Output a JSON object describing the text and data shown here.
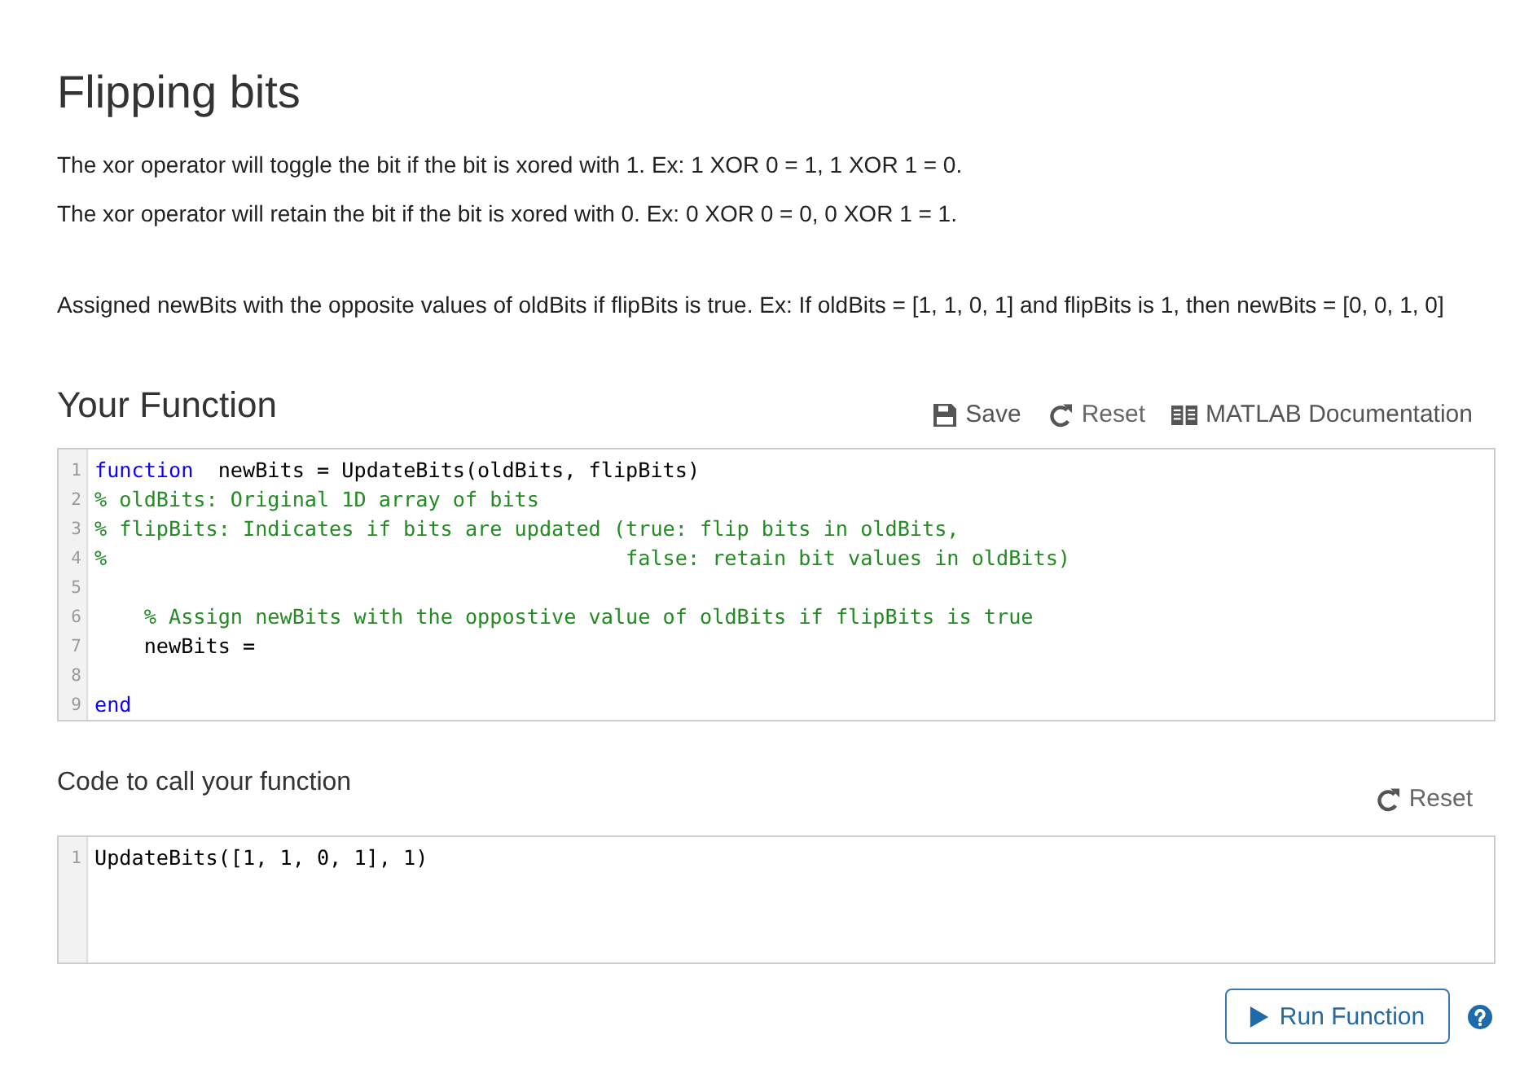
{
  "title": "Flipping bits",
  "notes": [
    "The xor operator will toggle the bit if the bit is xored with 1. Ex: 1 XOR 0 = 1, 1 XOR 1 = 0.",
    "The xor operator will retain the bit if the bit is xored with 0. Ex: 0 XOR 0 = 0, 0 XOR 1 = 1."
  ],
  "task": "Assigned newBits with the opposite values of oldBits if flipBits is true. Ex: If oldBits = [1, 1, 0, 1] and flipBits is 1, then newBits = [0, 0, 1, 0]",
  "function_editor": {
    "heading": "Your Function",
    "toolbar": [
      {
        "kind": "save",
        "label": "Save"
      },
      {
        "kind": "reset",
        "label": "Reset"
      },
      {
        "kind": "docs",
        "label": "MATLAB Documentation"
      }
    ],
    "lines": [
      {
        "number": "1",
        "tokens": [
          {
            "kind": "keyword",
            "text": "function"
          },
          {
            "kind": "plain",
            "text": "  newBits = UpdateBits(oldBits, flipBits)"
          }
        ]
      },
      {
        "number": "2",
        "tokens": [
          {
            "kind": "comment",
            "text": "% oldBits: Original 1D array of bits"
          }
        ]
      },
      {
        "number": "3",
        "tokens": [
          {
            "kind": "comment",
            "text": "% flipBits: Indicates if bits are updated (true: flip bits in oldBits,"
          }
        ]
      },
      {
        "number": "4",
        "tokens": [
          {
            "kind": "comment",
            "text": "%                                          false: retain bit values in oldBits)"
          }
        ]
      },
      {
        "number": "5"
      },
      {
        "number": "6",
        "tokens": [
          {
            "kind": "comment",
            "text": "    % Assign newBits with the oppostive value of oldBits if flipBits is true"
          }
        ]
      },
      {
        "number": "7",
        "tokens": [
          {
            "kind": "plain",
            "text": "    newBits ="
          }
        ]
      },
      {
        "number": "8"
      },
      {
        "number": "9",
        "tokens": [
          {
            "kind": "keyword",
            "text": "end"
          }
        ]
      }
    ]
  },
  "call_editor": {
    "heading": "Code to call your function",
    "toolbar": [
      {
        "kind": "reset",
        "label": "Reset"
      }
    ],
    "lines": [
      {
        "number": "1",
        "tokens": [
          {
            "kind": "plain",
            "text": "UpdateBits([1, 1, 0, 1], 1)"
          }
        ]
      }
    ]
  },
  "run_button": {
    "label": "Run Function"
  }
}
